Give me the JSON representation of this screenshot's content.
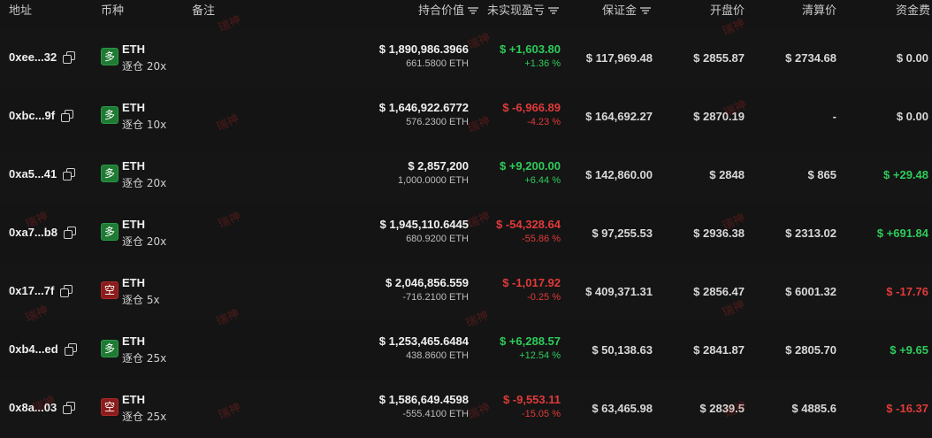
{
  "header": {
    "address": "地址",
    "coin": "币种",
    "note": "备注",
    "position_value": "持合价值",
    "unrealized_pnl": "未实现盈亏",
    "margin": "保证金",
    "open_price": "开盘价",
    "liq_price": "清算价",
    "funding": "资金费"
  },
  "watermark": "瑞神",
  "colors": {
    "long": "#1f7a34",
    "short": "#8a1c1c",
    "positive": "#2ecb5a",
    "negative": "#e03a3a",
    "background": "#141414"
  },
  "rows": [
    {
      "address": "0xee...32",
      "side": "多",
      "side_type": "long",
      "coin": "ETH",
      "leverage": "逐仓 20x",
      "position_value": "$ 1,890,986.3966",
      "quantity": "661.5800 ETH",
      "pnl": "$ +1,603.80",
      "pnl_pct": "+1.36 %",
      "pnl_type": "pos",
      "margin": "$ 117,969.48",
      "open_price": "$ 2855.87",
      "liq_price": "$ 2734.68",
      "funding": "$ 0.00",
      "funding_type": "neu"
    },
    {
      "address": "0xbc...9f",
      "side": "多",
      "side_type": "long",
      "coin": "ETH",
      "leverage": "逐仓 10x",
      "position_value": "$ 1,646,922.6772",
      "quantity": "576.2300 ETH",
      "pnl": "$ -6,966.89",
      "pnl_pct": "-4.23 %",
      "pnl_type": "neg",
      "margin": "$ 164,692.27",
      "open_price": "$ 2870.19",
      "liq_price": "-",
      "funding": "$ 0.00",
      "funding_type": "neu"
    },
    {
      "address": "0xa5...41",
      "side": "多",
      "side_type": "long",
      "coin": "ETH",
      "leverage": "逐仓 20x",
      "position_value": "$ 2,857,200",
      "quantity": "1,000.0000 ETH",
      "pnl": "$ +9,200.00",
      "pnl_pct": "+6.44 %",
      "pnl_type": "pos",
      "margin": "$ 142,860.00",
      "open_price": "$ 2848",
      "liq_price": "$ 865",
      "funding": "$ +29.48",
      "funding_type": "pos"
    },
    {
      "address": "0xa7...b8",
      "side": "多",
      "side_type": "long",
      "coin": "ETH",
      "leverage": "逐仓 20x",
      "position_value": "$ 1,945,110.6445",
      "quantity": "680.9200 ETH",
      "pnl": "$ -54,328.64",
      "pnl_pct": "-55.86 %",
      "pnl_type": "neg",
      "margin": "$ 97,255.53",
      "open_price": "$ 2936.38",
      "liq_price": "$ 2313.02",
      "funding": "$ +691.84",
      "funding_type": "pos"
    },
    {
      "address": "0x17...7f",
      "side": "空",
      "side_type": "short",
      "coin": "ETH",
      "leverage": "逐仓 5x",
      "position_value": "$ 2,046,856.559",
      "quantity": "-716.2100 ETH",
      "pnl": "$ -1,017.92",
      "pnl_pct": "-0.25 %",
      "pnl_type": "neg",
      "margin": "$ 409,371.31",
      "open_price": "$ 2856.47",
      "liq_price": "$ 6001.32",
      "funding": "$ -17.76",
      "funding_type": "neg"
    },
    {
      "address": "0xb4...ed",
      "side": "多",
      "side_type": "long",
      "coin": "ETH",
      "leverage": "逐仓 25x",
      "position_value": "$ 1,253,465.6484",
      "quantity": "438.8600 ETH",
      "pnl": "$ +6,288.57",
      "pnl_pct": "+12.54 %",
      "pnl_type": "pos",
      "margin": "$ 50,138.63",
      "open_price": "$ 2841.87",
      "liq_price": "$ 2805.70",
      "funding": "$ +9.65",
      "funding_type": "pos"
    },
    {
      "address": "0x8a...03",
      "side": "空",
      "side_type": "short",
      "coin": "ETH",
      "leverage": "逐仓 25x",
      "position_value": "$ 1,586,649.4598",
      "quantity": "-555.4100 ETH",
      "pnl": "$ -9,553.11",
      "pnl_pct": "-15.05 %",
      "pnl_type": "neg",
      "margin": "$ 63,465.98",
      "open_price": "$ 2839.5",
      "liq_price": "$ 4885.6",
      "funding": "$ -16.37",
      "funding_type": "neg"
    }
  ]
}
